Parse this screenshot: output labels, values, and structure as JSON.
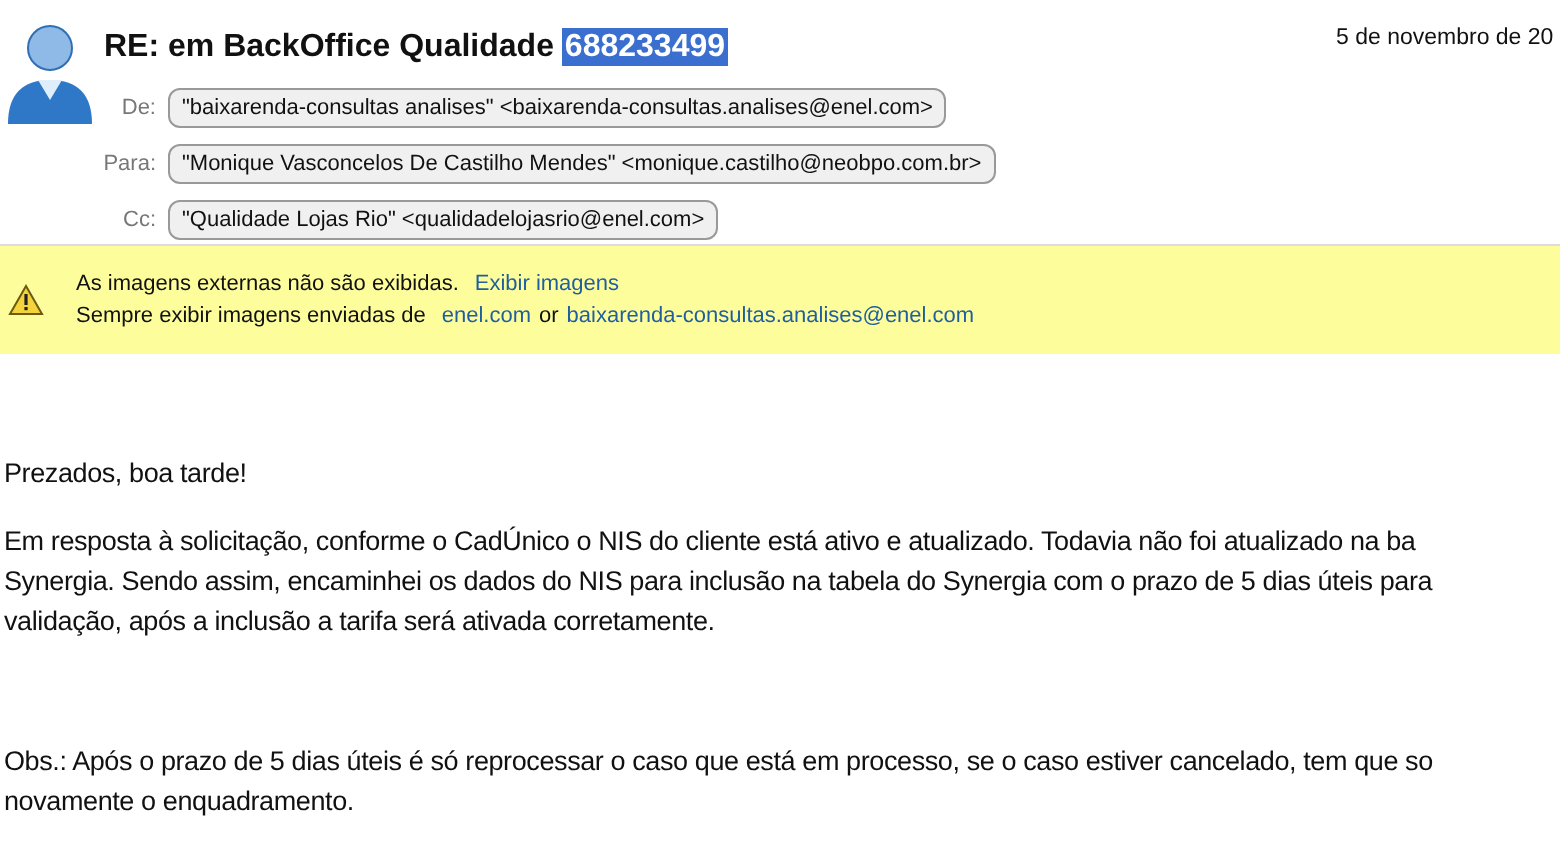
{
  "header": {
    "subject": [
      {
        "text": "RE: em BackOffice Qualidade",
        "selected": false
      },
      {
        "text": "688233499",
        "selected": true
      }
    ],
    "date": "5 de novembro de 20",
    "recipients": [
      {
        "label": "De:",
        "address": "\"baixarenda-consultas analises\" <baixarenda-consultas.analises@enel.com>"
      },
      {
        "label": "Para:",
        "address": "\"Monique Vasconcelos De Castilho Mendes\" <monique.castilho@neobpo.com.br>"
      },
      {
        "label": "Cc:",
        "address": "\"Qualidade Lojas Rio\" <qualidadelojasrio@enel.com>"
      }
    ]
  },
  "notice": {
    "message": "As imagens externas não são exibidas.",
    "action": "Exibir imagens",
    "always_text": "Sempre exibir imagens enviadas de",
    "domain_link": "enel.com",
    "or_text": "or",
    "sender_link": "baixarenda-consultas.analises@enel.com"
  },
  "body": {
    "paragraphs": [
      [
        "Prezados, boa tarde!"
      ],
      [
        "Em resposta à solicitação, conforme o CadÚnico o NIS do cliente está ativo e atualizado. Todavia não foi atualizado na ba",
        "Synergia. Sendo assim, encaminhei os dados do NIS para inclusão na tabela do Synergia com o prazo de 5 dias úteis para",
        "validação, após a inclusão a tarifa será ativada corretamente."
      ],
      [
        "Obs.: Após o prazo de 5 dias úteis é só reprocessar o caso que está em processo, se o caso estiver cancelado, tem que so",
        "novamente o enquadramento."
      ]
    ]
  }
}
